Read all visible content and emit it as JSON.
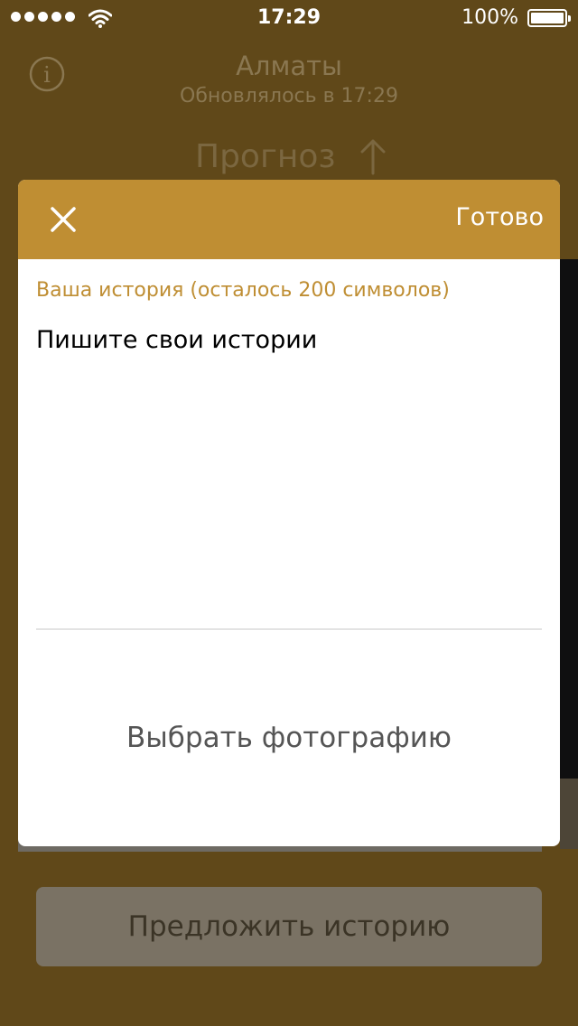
{
  "status_bar": {
    "time": "17:29",
    "battery": "100%",
    "icons": [
      "signal-dots-icon",
      "wifi-icon",
      "battery-icon"
    ]
  },
  "header": {
    "city": "Алматы",
    "updated": "Обновлялось в 17:29",
    "forecast_label": "Прогноз",
    "icons": [
      "info-icon",
      "arrow-up-icon"
    ]
  },
  "modal": {
    "done_label": "Готово",
    "story_label": "Ваша история (осталось 200 символов)",
    "story_placeholder": "Пишите свои истории",
    "choose_photo_label": "Выбрать фотографию",
    "icons": [
      "close-icon"
    ]
  },
  "footer": {
    "suggest_label": "Предложить историю"
  },
  "colors": {
    "accent": "#bf8e33",
    "backdrop": "#604819",
    "text_dark": "#000000"
  }
}
